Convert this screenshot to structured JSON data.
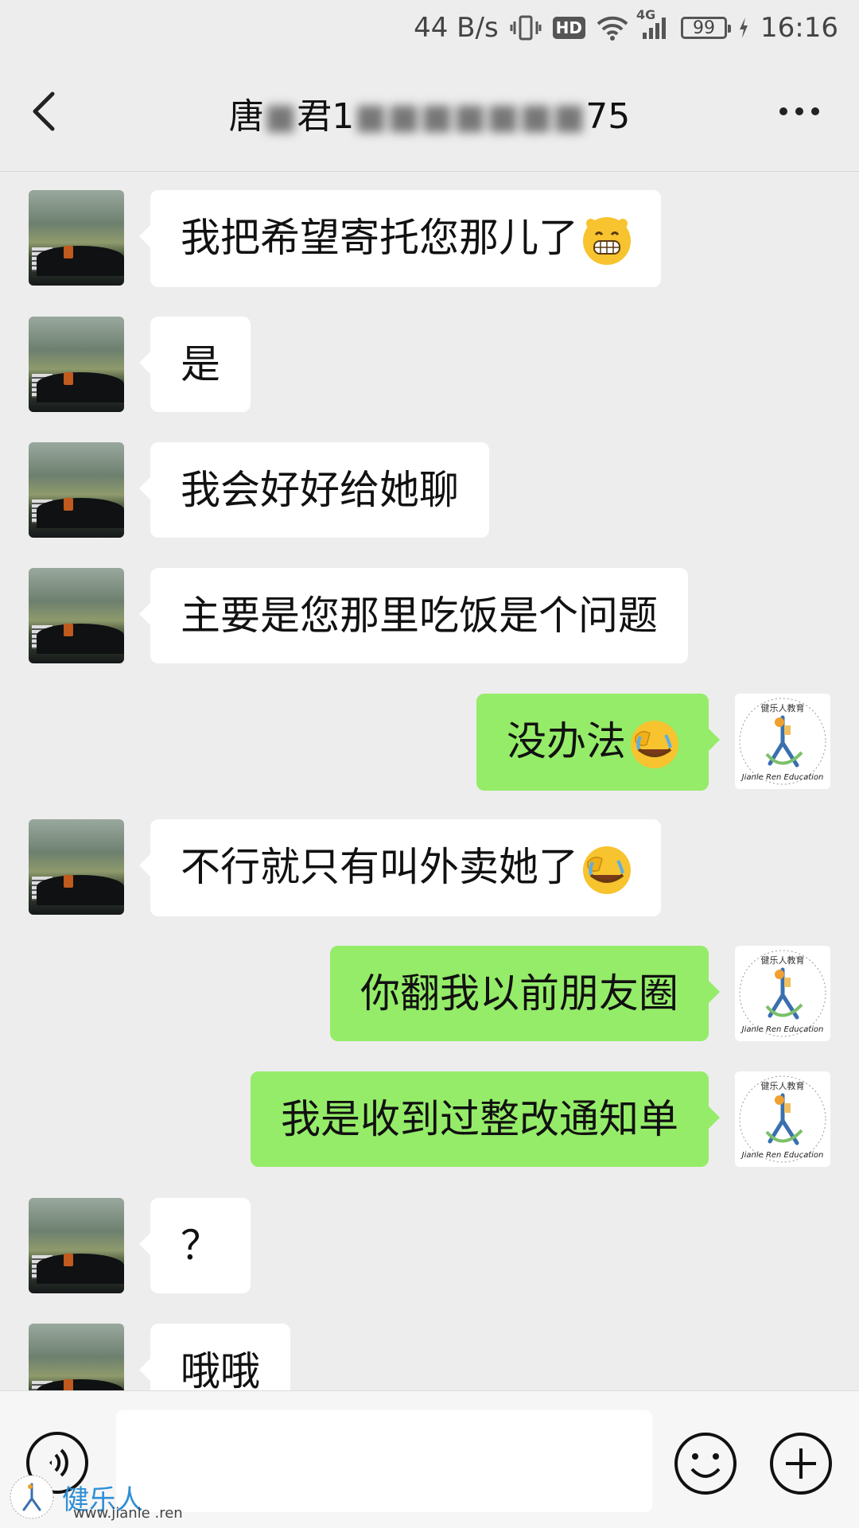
{
  "status_bar": {
    "speed": "44 B/s",
    "network": "4G",
    "hd_badge": "HD",
    "battery": "99",
    "time": "16:16"
  },
  "header": {
    "title_prefix": "唐",
    "title_blurred_1": "■",
    "title_mid": "君1",
    "title_blurred_2": "■■■■■■■",
    "title_suffix": "75",
    "back_icon": "chevron-left-icon",
    "more_icon": "more-dots-icon"
  },
  "messages": [
    {
      "side": "left",
      "text": "我把希望寄托您那儿了",
      "emoji": "grin"
    },
    {
      "side": "left",
      "text": "是"
    },
    {
      "side": "left",
      "text": "我会好好给她聊"
    },
    {
      "side": "left",
      "text": "主要是您那里吃饭是个问题"
    },
    {
      "side": "right",
      "text": "没办法",
      "emoji": "facepalm"
    },
    {
      "side": "left",
      "text": "不行就只有叫外卖她了",
      "emoji": "facepalm"
    },
    {
      "side": "right",
      "text": "你翻我以前朋友圈"
    },
    {
      "side": "right",
      "text": "我是收到过整改通知单"
    },
    {
      "side": "left",
      "text": "？"
    },
    {
      "side": "left",
      "text": "哦哦"
    }
  ],
  "self_avatar": {
    "top_text": "健乐人教育",
    "bottom_text": "Jianle Ren Education"
  },
  "input_bar": {
    "placeholder": "",
    "voice_icon": "voice-icon",
    "emoji_icon": "emoji-icon",
    "plus_icon": "plus-icon"
  },
  "watermark": {
    "text": "健乐人",
    "url": "www.jianle .ren"
  },
  "colors": {
    "background": "#ededed",
    "bubble_self": "#95ec69",
    "bubble_other": "#ffffff"
  }
}
